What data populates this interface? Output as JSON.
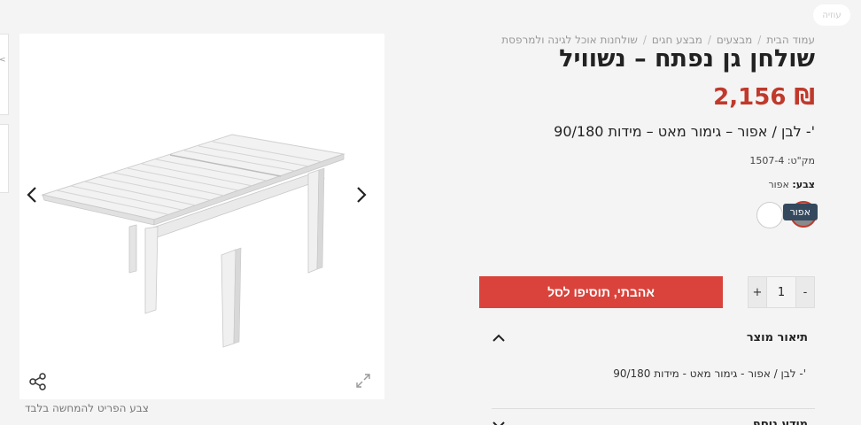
{
  "breadcrumb": {
    "items": [
      "עמוד הבית",
      "מבצעים",
      "מבצע חגים",
      "שולחנות אוכל לגינה ולמרפסת"
    ],
    "separator": "/"
  },
  "logo": {
    "text": "עוזיה"
  },
  "product": {
    "title": "שולחן גן נפתח – נשוויל",
    "price": "₪ 2,156",
    "subtitle": "'- לבן / אפור – גימור מאט – מידות 90/180",
    "sku": "מק\"ט: 1507-4",
    "color_label": "צבע:",
    "color_value": "אפור",
    "swatch_tooltip": "אפור"
  },
  "quantity": {
    "minus": "-",
    "value": "1",
    "plus": "+"
  },
  "cart": {
    "add_label": "אהבתי, תוסיפו לסל"
  },
  "accordion": {
    "description_title": "תיאור מוצר",
    "description_text": "'- לבן / אפור - גימור מאט - מידות 90/180",
    "more_title": "מידע נוסף"
  },
  "gallery": {
    "note": "צבע הפריט להמחשה בלבד"
  },
  "colors": {
    "accent": "#d9433b",
    "price": "#c0392b",
    "tooltip": "#34495e"
  },
  "icons": [
    "chevron-left-icon",
    "chevron-right-icon",
    "share-icon",
    "expand-icon",
    "chevron-up-icon",
    "chevron-down-icon"
  ]
}
